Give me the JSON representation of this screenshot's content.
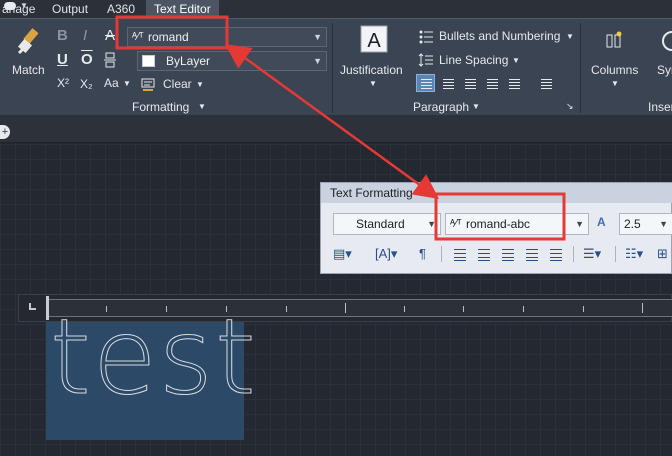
{
  "tabs": {
    "manage": "anage",
    "output": "Output",
    "a360": "A360",
    "text_editor": "Text Editor"
  },
  "ribbon": {
    "match_label": "Match",
    "bold": "B",
    "italic": "I",
    "strike": "A",
    "underline": "U",
    "overline": "O",
    "superscript": "X²",
    "subscript": "X₂",
    "case": "Aa",
    "font_value": "romand",
    "color_value": "ByLayer",
    "clear_label": "Clear",
    "formatting_title": "Formatting",
    "justification_label": "Justification",
    "bullets_label": "Bullets and Numbering",
    "line_spacing_label": "Line Spacing",
    "paragraph_title": "Paragraph",
    "columns_label": "Columns",
    "sym_label": "Sym",
    "insert_title": "Inser"
  },
  "text_formatting": {
    "title": "Text Formatting",
    "style_value": "Standard",
    "font_value": "romand-abc",
    "height_value": "2.5"
  },
  "canvas": {
    "text": "test"
  },
  "colors": {
    "highlight": "#e53935",
    "active_tab": "#4b5563",
    "selection": "#2c4a67"
  }
}
